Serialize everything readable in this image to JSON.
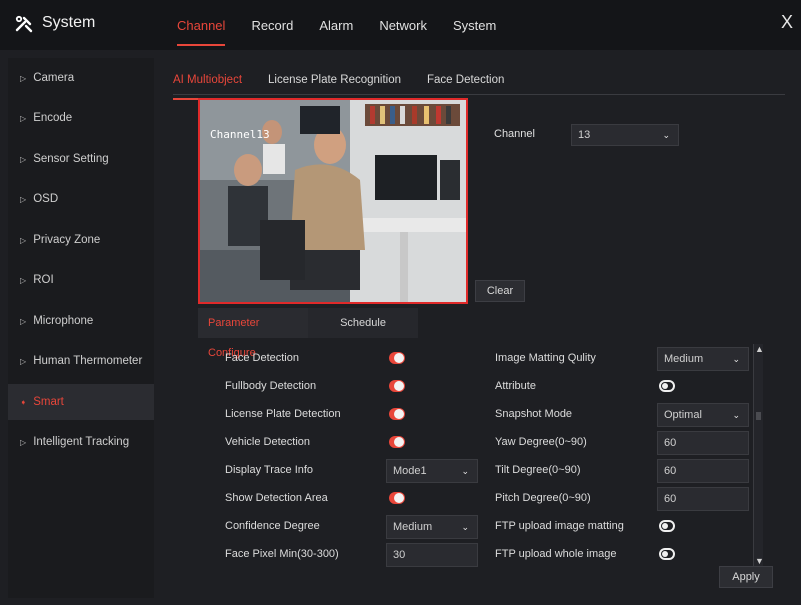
{
  "header": {
    "title": "System",
    "close_label": "X",
    "nav": [
      {
        "label": "Channel",
        "active": true
      },
      {
        "label": "Record",
        "active": false
      },
      {
        "label": "Alarm",
        "active": false
      },
      {
        "label": "Network",
        "active": false
      },
      {
        "label": "System",
        "active": false
      }
    ]
  },
  "sidebar": {
    "items": [
      {
        "label": "Camera",
        "active": false
      },
      {
        "label": "Encode",
        "active": false
      },
      {
        "label": "Sensor Setting",
        "active": false
      },
      {
        "label": "OSD",
        "active": false
      },
      {
        "label": "Privacy Zone",
        "active": false
      },
      {
        "label": "ROI",
        "active": false
      },
      {
        "label": "Microphone",
        "active": false
      },
      {
        "label": "Human Thermometer",
        "active": false
      },
      {
        "label": "Smart",
        "active": true
      },
      {
        "label": "Intelligent Tracking",
        "active": false
      }
    ]
  },
  "subtabs": [
    {
      "label": "AI Multiobject",
      "active": true
    },
    {
      "label": "License Plate Recognition",
      "active": false
    },
    {
      "label": "Face Detection",
      "active": false
    }
  ],
  "preview": {
    "osd_text": "Channel13"
  },
  "clear_label": "Clear",
  "channel": {
    "label": "Channel",
    "value": "13"
  },
  "panel_tabs": [
    {
      "label": "Parameter Configure",
      "active": true
    },
    {
      "label": "Schedule",
      "active": false
    }
  ],
  "left_settings": [
    {
      "label": "Face Detection",
      "type": "toggle",
      "on": true
    },
    {
      "label": "Fullbody Detection",
      "type": "toggle",
      "on": true
    },
    {
      "label": "License Plate Detection",
      "type": "toggle",
      "on": true
    },
    {
      "label": "Vehicle Detection",
      "type": "toggle",
      "on": true
    },
    {
      "label": "Display Trace Info",
      "type": "select",
      "value": "Mode1"
    },
    {
      "label": "Show Detection Area",
      "type": "toggle",
      "on": true
    },
    {
      "label": "Confidence Degree",
      "type": "select",
      "value": "Medium"
    },
    {
      "label": "Face Pixel Min(30-300)",
      "type": "input",
      "value": "30"
    }
  ],
  "right_settings": [
    {
      "label": "Image Matting Qulity",
      "type": "select",
      "value": "Medium"
    },
    {
      "label": "Attribute",
      "type": "toggle",
      "on": false
    },
    {
      "label": "Snapshot Mode",
      "type": "select",
      "value": "Optimal"
    },
    {
      "label": "Yaw Degree(0~90)",
      "type": "input",
      "value": "60"
    },
    {
      "label": "Tilt Degree(0~90)",
      "type": "input",
      "value": "60"
    },
    {
      "label": "Pitch Degree(0~90)",
      "type": "input",
      "value": "60"
    },
    {
      "label": "FTP upload image matting",
      "type": "toggle",
      "on": false
    },
    {
      "label": "FTP upload whole image",
      "type": "toggle",
      "on": false
    }
  ],
  "apply_label": "Apply",
  "colors": {
    "accent": "#e8463a",
    "background": "#1e1f23",
    "header": "#141518"
  }
}
